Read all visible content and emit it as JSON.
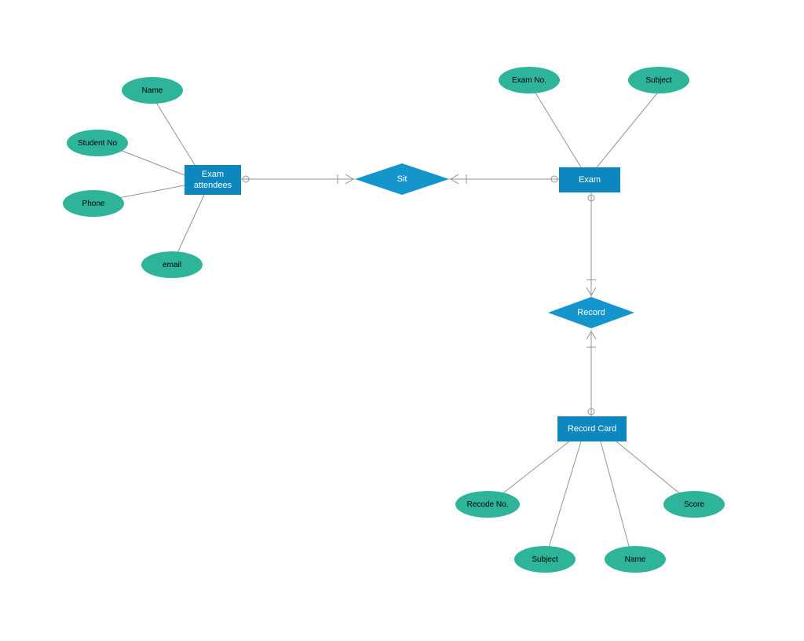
{
  "entities": {
    "exam_attendees": "Exam\nattendees",
    "exam": "Exam",
    "record_card": "Record Card"
  },
  "relationships": {
    "sit": "Sit",
    "record": "Record"
  },
  "attributes": {
    "name1": "Name",
    "student_no": "Student No",
    "phone": "Phone",
    "email": "email",
    "exam_no": "Exam No.",
    "subject1": "Subject",
    "recode_no": "Recode No.",
    "subject2": "Subject",
    "name2": "Name",
    "score": "Score"
  },
  "colors": {
    "entity": "#0d87bd",
    "relationship": "#1496cc",
    "attribute": "#2db499",
    "line": "#939393"
  }
}
